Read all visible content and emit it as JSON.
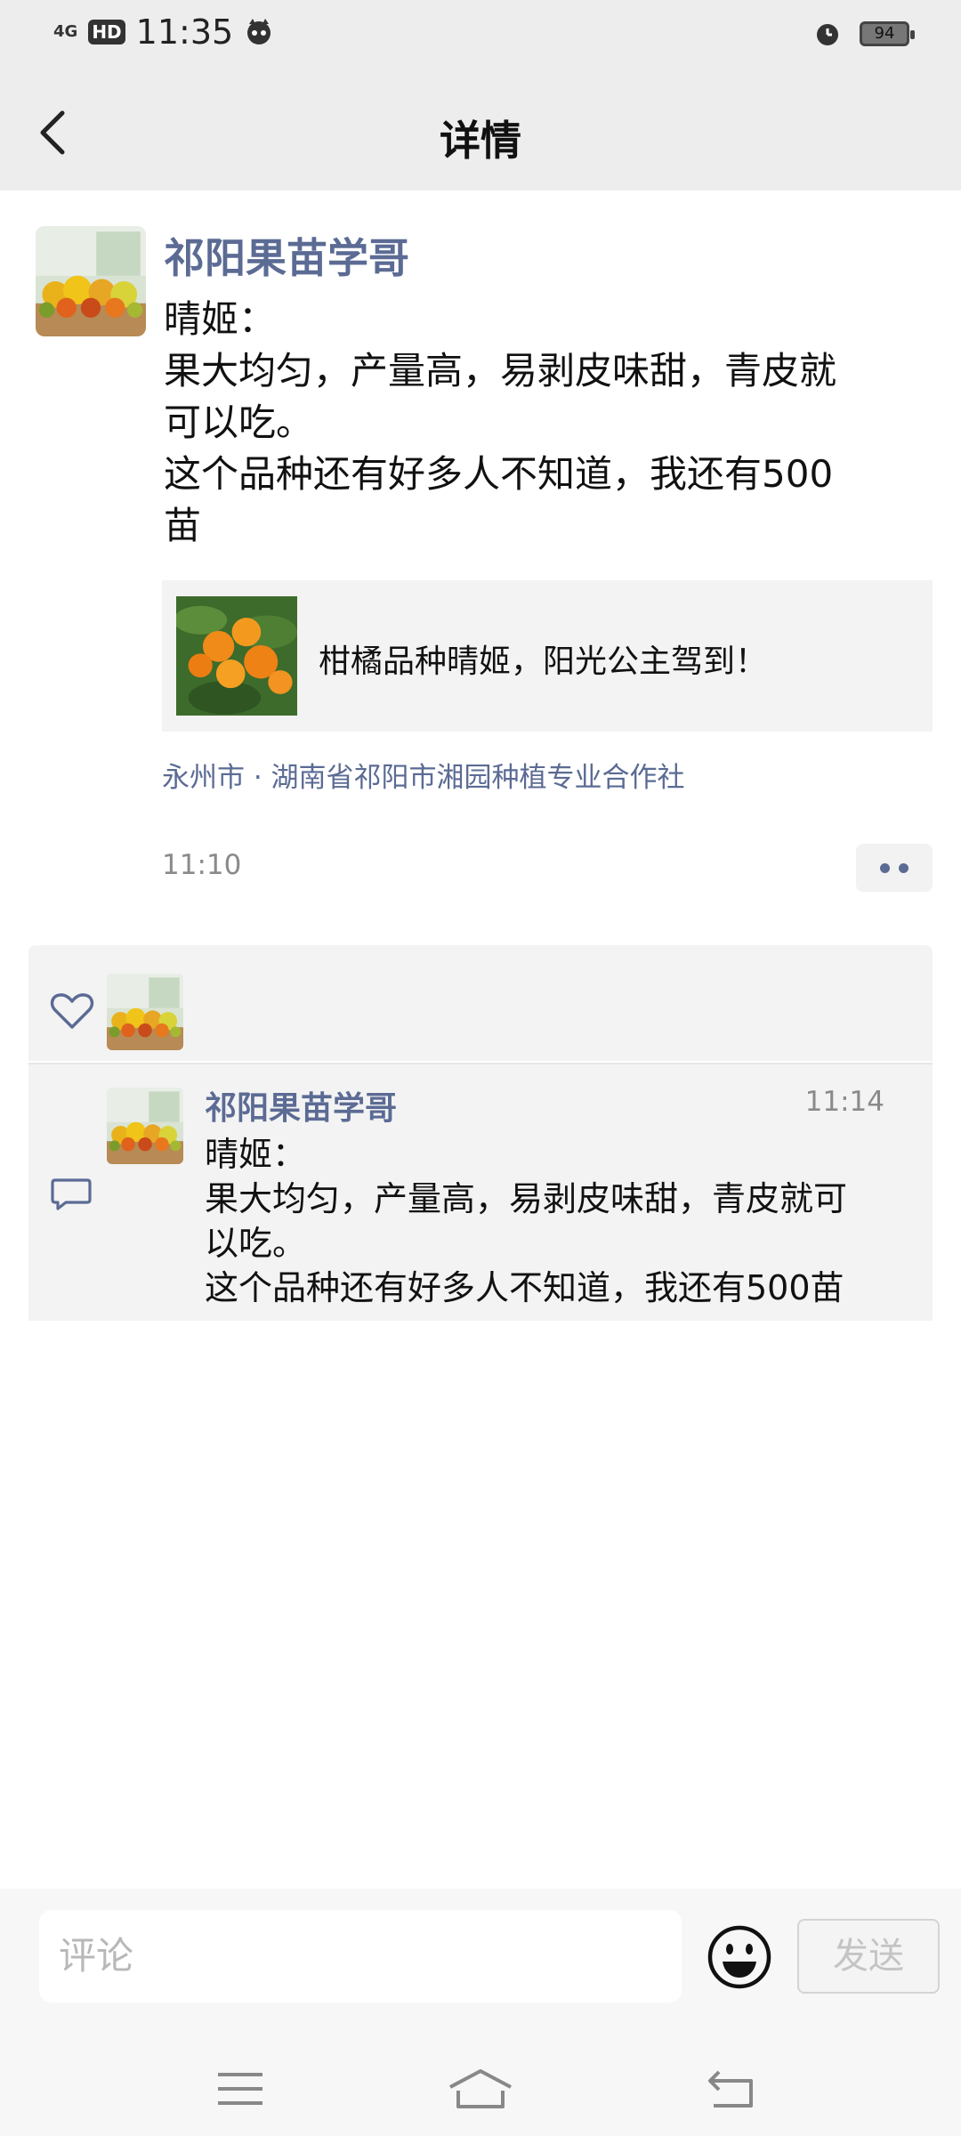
{
  "status_bar": {
    "network": "4G",
    "hd": "HD",
    "time": "11:35",
    "battery": "94"
  },
  "header": {
    "title": "详情"
  },
  "post": {
    "author": "祁阳果苗学哥",
    "text_lines": [
      "晴姬：",
      "果大均匀，产量高，易剥皮味甜，青皮就",
      "可以吃。",
      "这个品种还有好多人不知道，我还有500",
      "苗"
    ],
    "link_title": "柑橘品种晴姬，阳光公主驾到！",
    "location": "永州市 · 湖南省祁阳市湘园种植专业合作社",
    "time": "11:10"
  },
  "comment": {
    "author": "祁阳果苗学哥",
    "time": "11:14",
    "text_lines": [
      "晴姬：",
      "果大均匀，产量高，易剥皮味甜，青皮就可",
      "以吃。",
      "这个品种还有好多人不知道，我还有500苗"
    ]
  },
  "input_bar": {
    "placeholder": "评论",
    "send_label": "发送"
  },
  "colors": {
    "accent_name": "#5b6b94",
    "bar_background": "#ededed",
    "panel_background": "#f3f3f3"
  },
  "icons": [
    "back-icon",
    "heart-icon",
    "comment-icon",
    "emoji-icon",
    "menu-icon",
    "home-icon",
    "return-icon",
    "alarm-icon",
    "battery-icon"
  ]
}
